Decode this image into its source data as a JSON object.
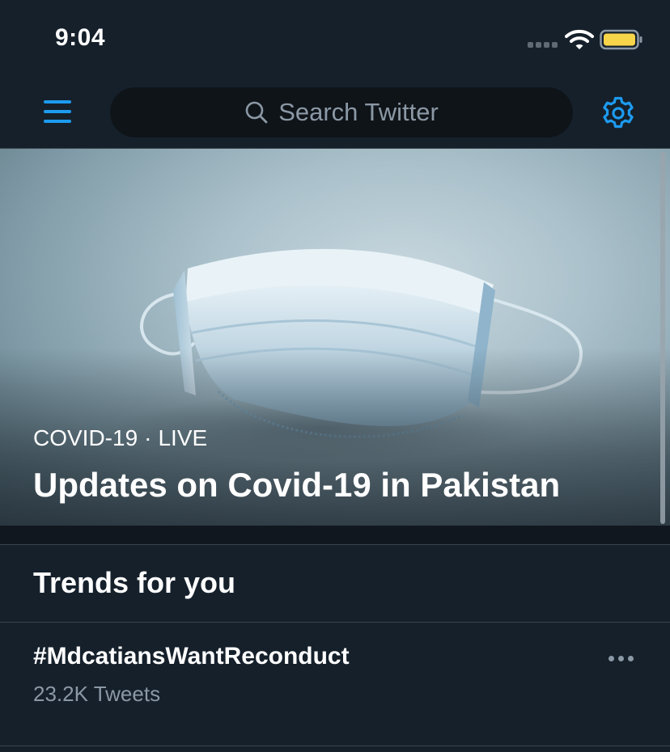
{
  "status_bar": {
    "time": "9:04",
    "icons": [
      "cellular-signal-icon",
      "wifi-icon",
      "battery-icon"
    ],
    "battery_color": "#f7d54a"
  },
  "header": {
    "menu_icon": "hamburger-menu-icon",
    "search": {
      "placeholder": "Search Twitter",
      "icon": "search-icon"
    },
    "settings_icon": "gear-icon",
    "accent_color": "#1d9bf0"
  },
  "hero": {
    "category": "COVID-19",
    "separator": "·",
    "status": "LIVE",
    "title": "Updates on Covid-19 in Pakistan",
    "image": "surgical-mask-image"
  },
  "trends": {
    "title": "Trends for you",
    "items": [
      {
        "name": "#MdcatiansWantReconduct",
        "count": "23.2K Tweets",
        "more_icon": "more-options-icon"
      }
    ]
  },
  "colors": {
    "background": "#15202b",
    "secondary_text": "#8b98a5",
    "divider": "#38444d"
  }
}
